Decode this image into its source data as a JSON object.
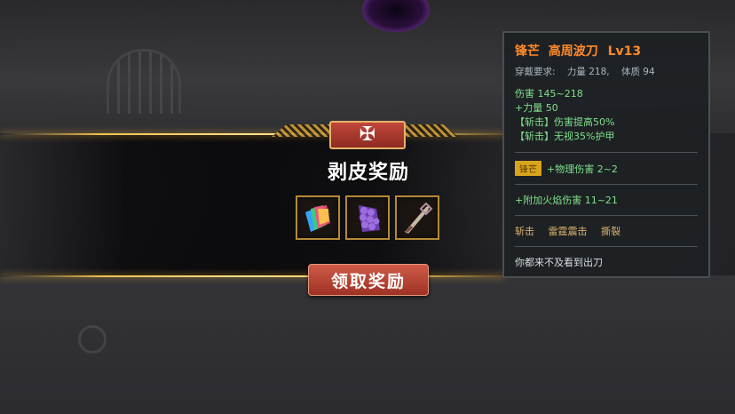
{
  "reward_panel": {
    "emblem_glyph": "✠",
    "title": "剥皮奖励",
    "items": [
      {
        "name": "rainbow-cards-icon"
      },
      {
        "name": "purple-scales-icon"
      },
      {
        "name": "blade-weapon-icon"
      }
    ],
    "claim_button": "领取奖励"
  },
  "tooltip": {
    "name": "锋芒",
    "item": "高周波刀",
    "level": "Lv13",
    "requirement_label": "穿戴要求:",
    "req_strength": "力量 218,",
    "req_constitution": "体质 94",
    "damage": "伤害  145~218",
    "strength_bonus": "+力量 50",
    "affix1": "【斩击】伤害提高50%",
    "affix2": "【斩击】无视35%护甲",
    "edge_badge": "锋芒",
    "edge_text": "+物理伤害 2~2",
    "fire": "+附加火焰伤害 11~21",
    "tags": [
      "斩击",
      "雷霆震击",
      "撕裂"
    ],
    "flavor": "你都来不及看到出刀"
  },
  "colors": {
    "gold": "#f0c050",
    "name_orange": "#ff8a2a",
    "stat_green": "#7fe08a",
    "button_red": "#cf5a46"
  }
}
